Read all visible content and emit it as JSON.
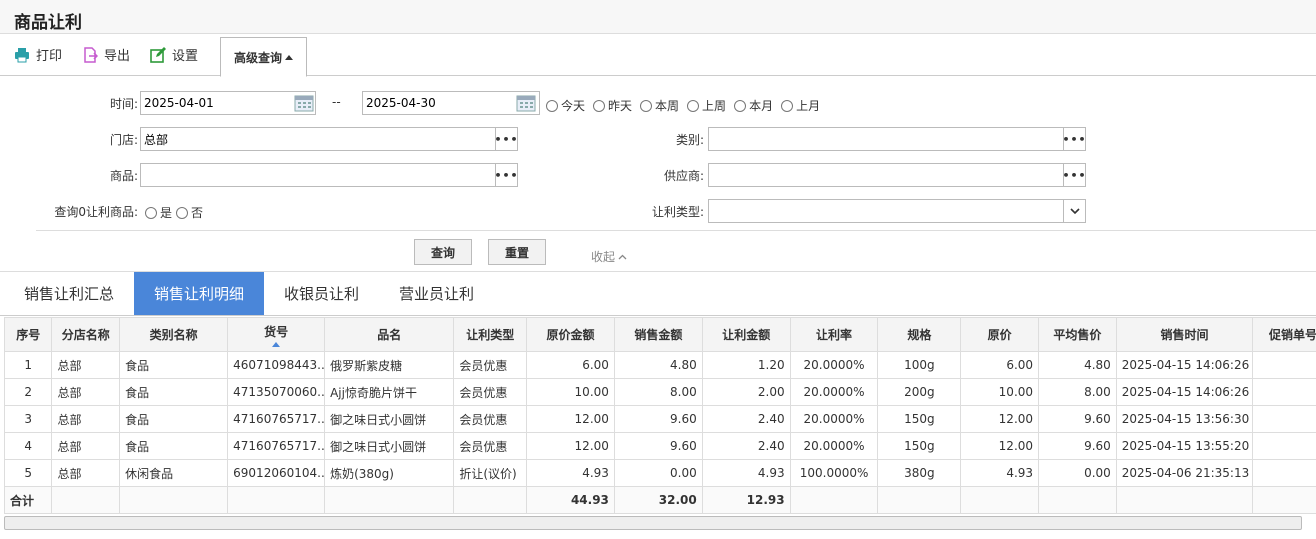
{
  "page_title": "商品让利",
  "toolbar": {
    "print": "打印",
    "export": "导出",
    "settings": "设置",
    "advanced": "高级查询"
  },
  "search": {
    "time_label": "时间:",
    "date_from": "2025-04-01",
    "date_sep": "--",
    "date_to": "2025-04-30",
    "quick_ranges": [
      "今天",
      "昨天",
      "本周",
      "上周",
      "本月",
      "上月"
    ],
    "store_label": "门店:",
    "store_value": "总部",
    "category_label": "类别:",
    "category_value": "",
    "product_label": "商品:",
    "product_value": "",
    "supplier_label": "供应商:",
    "supplier_value": "",
    "zero_label": "查询0让利商品:",
    "yes": "是",
    "no": "否",
    "discount_type_label": "让利类型:",
    "discount_type_value": "",
    "query_btn": "查询",
    "reset_btn": "重置",
    "collapse": "收起"
  },
  "tabs": [
    "销售让利汇总",
    "销售让利明细",
    "收银员让利",
    "营业员让利"
  ],
  "active_tab": 1,
  "table": {
    "headers": [
      "序号",
      "分店名称",
      "类别名称",
      "货号",
      "品名",
      "让利类型",
      "原价金额",
      "销售金额",
      "让利金额",
      "让利率",
      "规格",
      "原价",
      "平均售价",
      "销售时间",
      "促销单号"
    ],
    "rows": [
      [
        "1",
        "总部",
        "食品",
        "46071098443...",
        "俄罗斯紫皮糖",
        "会员优惠",
        "6.00",
        "4.80",
        "1.20",
        "20.0000%",
        "100g",
        "6.00",
        "4.80",
        "2025-04-15 14:06:26",
        ""
      ],
      [
        "2",
        "总部",
        "食品",
        "47135070060...",
        "Ajj惊奇脆片饼干",
        "会员优惠",
        "10.00",
        "8.00",
        "2.00",
        "20.0000%",
        "200g",
        "10.00",
        "8.00",
        "2025-04-15 14:06:26",
        ""
      ],
      [
        "3",
        "总部",
        "食品",
        "47160765717...",
        "御之味日式小圆饼",
        "会员优惠",
        "12.00",
        "9.60",
        "2.40",
        "20.0000%",
        "150g",
        "12.00",
        "9.60",
        "2025-04-15 13:56:30",
        ""
      ],
      [
        "4",
        "总部",
        "食品",
        "47160765717...",
        "御之味日式小圆饼",
        "会员优惠",
        "12.00",
        "9.60",
        "2.40",
        "20.0000%",
        "150g",
        "12.00",
        "9.60",
        "2025-04-15 13:55:20",
        ""
      ],
      [
        "5",
        "总部",
        "休闲食品",
        "69012060104...",
        "炼奶(380g)",
        "折让(议价)",
        "4.93",
        "0.00",
        "4.93",
        "100.0000%",
        "380g",
        "4.93",
        "0.00",
        "2025-04-06 21:35:13",
        ""
      ]
    ],
    "total_label": "合计",
    "totals": {
      "original": "44.93",
      "sales": "32.00",
      "discount": "12.93"
    }
  },
  "colors": {
    "accent": "#4a86d9",
    "print_icon": "#2a9fa8",
    "export_icon": "#c65ccf",
    "settings_icon": "#2e9a3a"
  }
}
